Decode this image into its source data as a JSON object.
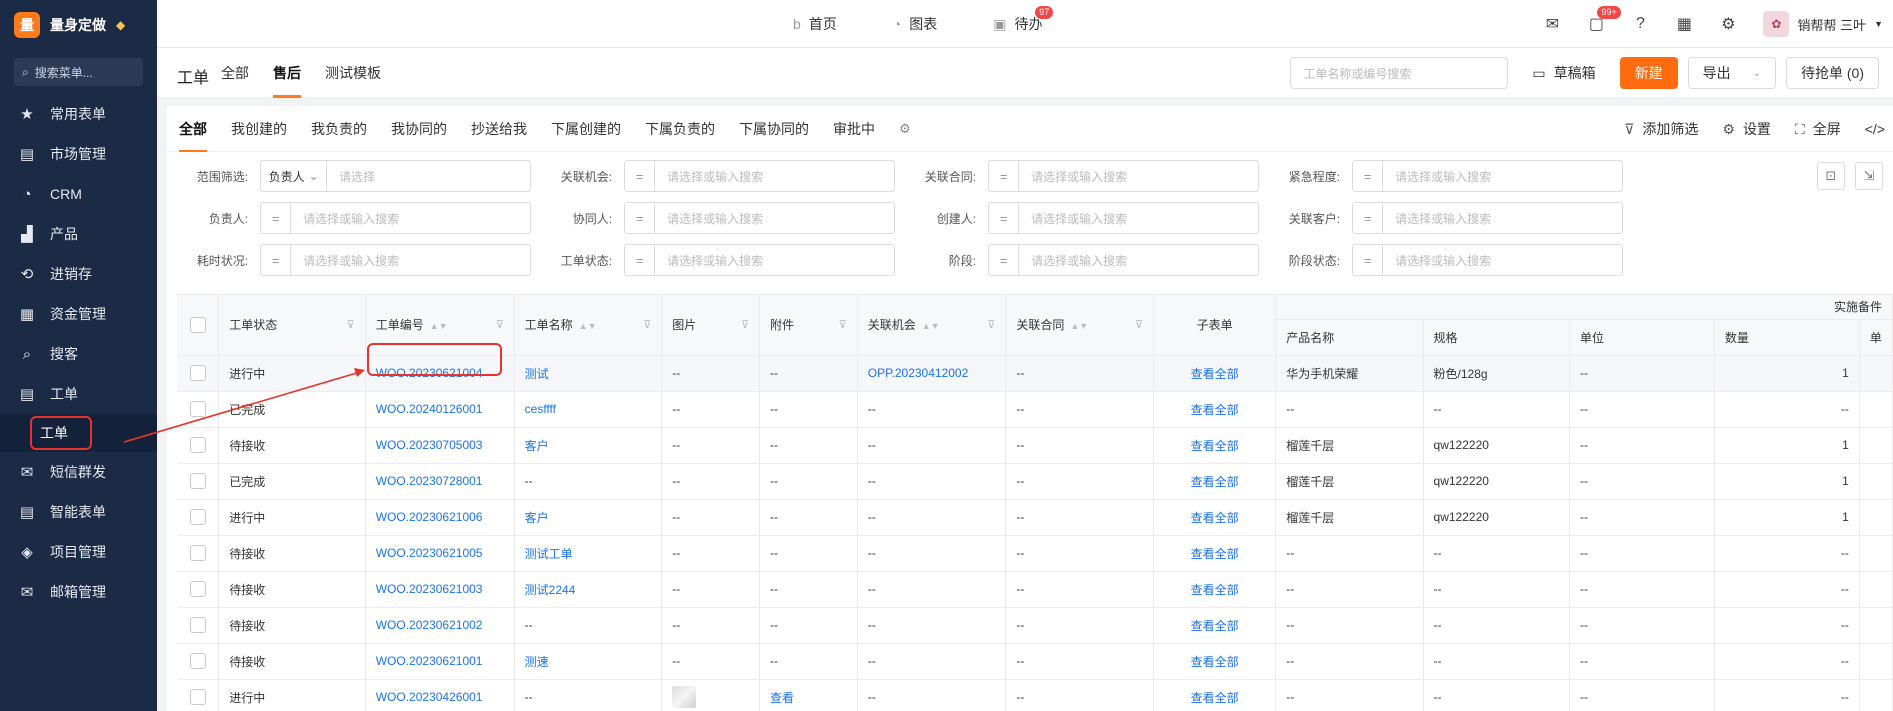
{
  "brand": {
    "logo": "量",
    "name": "量身定做"
  },
  "sidebar": {
    "search_placeholder": "搜索菜单...",
    "items": [
      {
        "label": "常用表单",
        "icon": "star-icon",
        "glyph": "★"
      },
      {
        "label": "市场管理",
        "icon": "clipboard-icon",
        "glyph": "▤"
      },
      {
        "label": "CRM",
        "icon": "pie-chart-icon",
        "glyph": "◔"
      },
      {
        "label": "产品",
        "icon": "boxes-icon",
        "glyph": "▟"
      },
      {
        "label": "进销存",
        "icon": "refresh-icon",
        "glyph": "⟲"
      },
      {
        "label": "资金管理",
        "icon": "finance-icon",
        "glyph": "▦"
      },
      {
        "label": "搜客",
        "icon": "search-icon",
        "glyph": "⌕"
      },
      {
        "label": "工单",
        "icon": "clipboard-icon",
        "glyph": "▤"
      }
    ],
    "sub_item": "工单",
    "items_after": [
      {
        "label": "短信群发",
        "icon": "mail-icon",
        "glyph": "✉"
      },
      {
        "label": "智能表单",
        "icon": "form-icon",
        "glyph": "▤"
      },
      {
        "label": "项目管理",
        "icon": "layers-icon",
        "glyph": "◈"
      },
      {
        "label": "邮箱管理",
        "icon": "envelope-icon",
        "glyph": "✉"
      }
    ]
  },
  "topbar": {
    "nav": [
      {
        "label": "首页",
        "glyph": "b"
      },
      {
        "label": "图表",
        "glyph": "◔"
      },
      {
        "label": "待办",
        "glyph": "▣",
        "badge": "97"
      }
    ],
    "chat_badge": "99+",
    "user_name": "销帮帮 三叶"
  },
  "header": {
    "title": "工单",
    "tabs": [
      "全部",
      "售后",
      "测试模板"
    ],
    "search_placeholder": "工单名称或编号搜索",
    "drafts": "草稿箱",
    "new_btn": "新建",
    "export_btn": "导出",
    "grab_btn": "待抢单 (0)"
  },
  "filter_tabs": {
    "tabs": [
      "全部",
      "我创建的",
      "我负责的",
      "我协同的",
      "抄送给我",
      "下属创建的",
      "下属负责的",
      "下属协同的",
      "审批中"
    ],
    "add_filter": "添加筛选",
    "settings": "设置",
    "fullscreen": "全屏",
    "code": "</>"
  },
  "filters": {
    "range_label": "范围筛选:",
    "range_op": "负责人",
    "range_placeholder": "请选择",
    "rows": [
      [
        {
          "label": "关联机会:",
          "ph": "请选择或输入搜索"
        },
        {
          "label": "关联合同:",
          "ph": "请选择或输入搜索"
        },
        {
          "label": "紧急程度:",
          "ph": "请选择或输入搜索"
        }
      ],
      [
        {
          "label": "负责人:",
          "ph": "请选择或输入搜索"
        },
        {
          "label": "协同人:",
          "ph": "请选择或输入搜索"
        },
        {
          "label": "创建人:",
          "ph": "请选择或输入搜索"
        },
        {
          "label": "关联客户:",
          "ph": "请选择或输入搜索"
        }
      ],
      [
        {
          "label": "耗时状况:",
          "ph": "请选择或输入搜索"
        },
        {
          "label": "工单状态:",
          "ph": "请选择或输入搜索"
        },
        {
          "label": "阶段:",
          "ph": "请选择或输入搜索"
        },
        {
          "label": "阶段状态:",
          "ph": "请选择或输入搜索"
        }
      ]
    ],
    "op": "="
  },
  "table": {
    "group_header": "实施备件",
    "headers": [
      "工单状态",
      "工单编号",
      "工单名称",
      "图片",
      "附件",
      "关联机会",
      "关联合同",
      "子表单"
    ],
    "sub_headers": [
      "产品名称",
      "规格",
      "单位",
      "数量",
      "单"
    ],
    "rows": [
      {
        "status": "进行中",
        "no": "WOO.20230621004",
        "name": "测试",
        "img": "--",
        "att": "--",
        "opp": "OPP.20230412002",
        "contract": "--",
        "sub": "查看全部",
        "product": "华为手机荣耀",
        "spec": "粉色/128g",
        "unit": "--",
        "qty": "1"
      },
      {
        "status": "已完成",
        "no": "WOO.20240126001",
        "name": "cesffff",
        "img": "--",
        "att": "--",
        "opp": "--",
        "contract": "--",
        "sub": "查看全部",
        "product": "--",
        "spec": "--",
        "unit": "--",
        "qty": "--"
      },
      {
        "status": "待接收",
        "no": "WOO.20230705003",
        "name": "客户",
        "img": "--",
        "att": "--",
        "opp": "--",
        "contract": "--",
        "sub": "查看全部",
        "product": "榴莲千层",
        "spec": "qw122220",
        "unit": "--",
        "qty": "1"
      },
      {
        "status": "已完成",
        "no": "WOO.20230728001",
        "name": "--",
        "img": "--",
        "att": "--",
        "opp": "--",
        "contract": "--",
        "sub": "查看全部",
        "product": "榴莲千层",
        "spec": "qw122220",
        "unit": "--",
        "qty": "1"
      },
      {
        "status": "进行中",
        "no": "WOO.20230621006",
        "name": "客户",
        "img": "--",
        "att": "--",
        "opp": "--",
        "contract": "--",
        "sub": "查看全部",
        "product": "榴莲千层",
        "spec": "qw122220",
        "unit": "--",
        "qty": "1"
      },
      {
        "status": "待接收",
        "no": "WOO.20230621005",
        "name": "测试工单",
        "img": "--",
        "att": "--",
        "opp": "--",
        "contract": "--",
        "sub": "查看全部",
        "product": "--",
        "spec": "--",
        "unit": "--",
        "qty": "--"
      },
      {
        "status": "待接收",
        "no": "WOO.20230621003",
        "name": "测试2244",
        "img": "--",
        "att": "--",
        "opp": "--",
        "contract": "--",
        "sub": "查看全部",
        "product": "--",
        "spec": "--",
        "unit": "--",
        "qty": "--"
      },
      {
        "status": "待接收",
        "no": "WOO.20230621002",
        "name": "--",
        "img": "--",
        "att": "--",
        "opp": "--",
        "contract": "--",
        "sub": "查看全部",
        "product": "--",
        "spec": "--",
        "unit": "--",
        "qty": "--"
      },
      {
        "status": "待接收",
        "no": "WOO.20230621001",
        "name": "测速",
        "img": "--",
        "att": "--",
        "opp": "--",
        "contract": "--",
        "sub": "查看全部",
        "product": "--",
        "spec": "--",
        "unit": "--",
        "qty": "--"
      },
      {
        "status": "进行中",
        "no": "WOO.20230426001",
        "name": "--",
        "img": "thumb",
        "att": "查看",
        "opp": "--",
        "contract": "--",
        "sub": "查看全部",
        "product": "--",
        "spec": "--",
        "unit": "--",
        "qty": "--"
      }
    ]
  }
}
